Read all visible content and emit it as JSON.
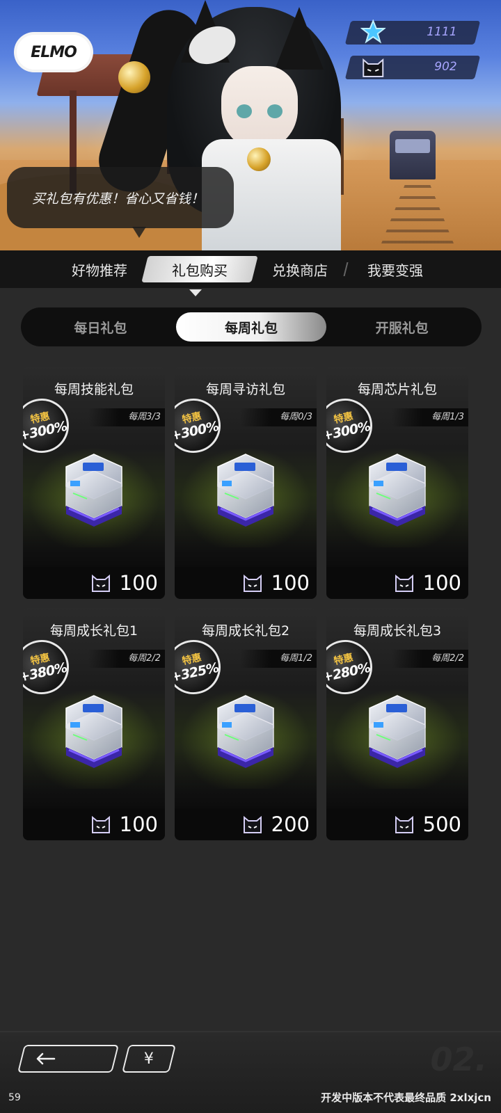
{
  "header": {
    "logo_text": "ELMO",
    "currency": [
      {
        "icon": "star-icon",
        "value": "1111"
      },
      {
        "icon": "cat-coin-icon",
        "value": "902"
      }
    ],
    "speech": "买礼包有优惠！省心又省钱！"
  },
  "main_tabs": [
    {
      "label": "好物推荐",
      "active": false
    },
    {
      "label": "礼包购买",
      "active": true
    },
    {
      "label": "兑换商店",
      "active": false
    },
    {
      "label": "我要变强",
      "active": false
    }
  ],
  "sub_tabs": [
    {
      "label": "每日礼包",
      "active": false
    },
    {
      "label": "每周礼包",
      "active": true
    },
    {
      "label": "开服礼包",
      "active": false
    }
  ],
  "packs": [
    {
      "title": "每周技能礼包",
      "limit": "每周3/3",
      "badge_top": "特惠",
      "badge_value": "+300%",
      "price": "100"
    },
    {
      "title": "每周寻访礼包",
      "limit": "每周0/3",
      "badge_top": "特惠",
      "badge_value": "+300%",
      "price": "100"
    },
    {
      "title": "每周芯片礼包",
      "limit": "每周1/3",
      "badge_top": "特惠",
      "badge_value": "+300%",
      "price": "100"
    },
    {
      "title": "每周成长礼包1",
      "limit": "每周2/2",
      "badge_top": "特惠",
      "badge_value": "+380%",
      "price": "100"
    },
    {
      "title": "每周成长礼包2",
      "limit": "每周1/2",
      "badge_top": "特惠",
      "badge_value": "+325%",
      "price": "200"
    },
    {
      "title": "每周成长礼包3",
      "limit": "每周2/2",
      "badge_top": "特惠",
      "badge_value": "+280%",
      "price": "500"
    }
  ],
  "footer": {
    "back_icon": "arrow-left-icon",
    "yen_label": "¥",
    "page_mark": "02.",
    "fps": "59",
    "disclaimer": "开发中版本不代表最终品质 2xlxjcn"
  },
  "colors": {
    "accent_purple": "#a8a6ff",
    "badge_gold": "#f3c342"
  }
}
